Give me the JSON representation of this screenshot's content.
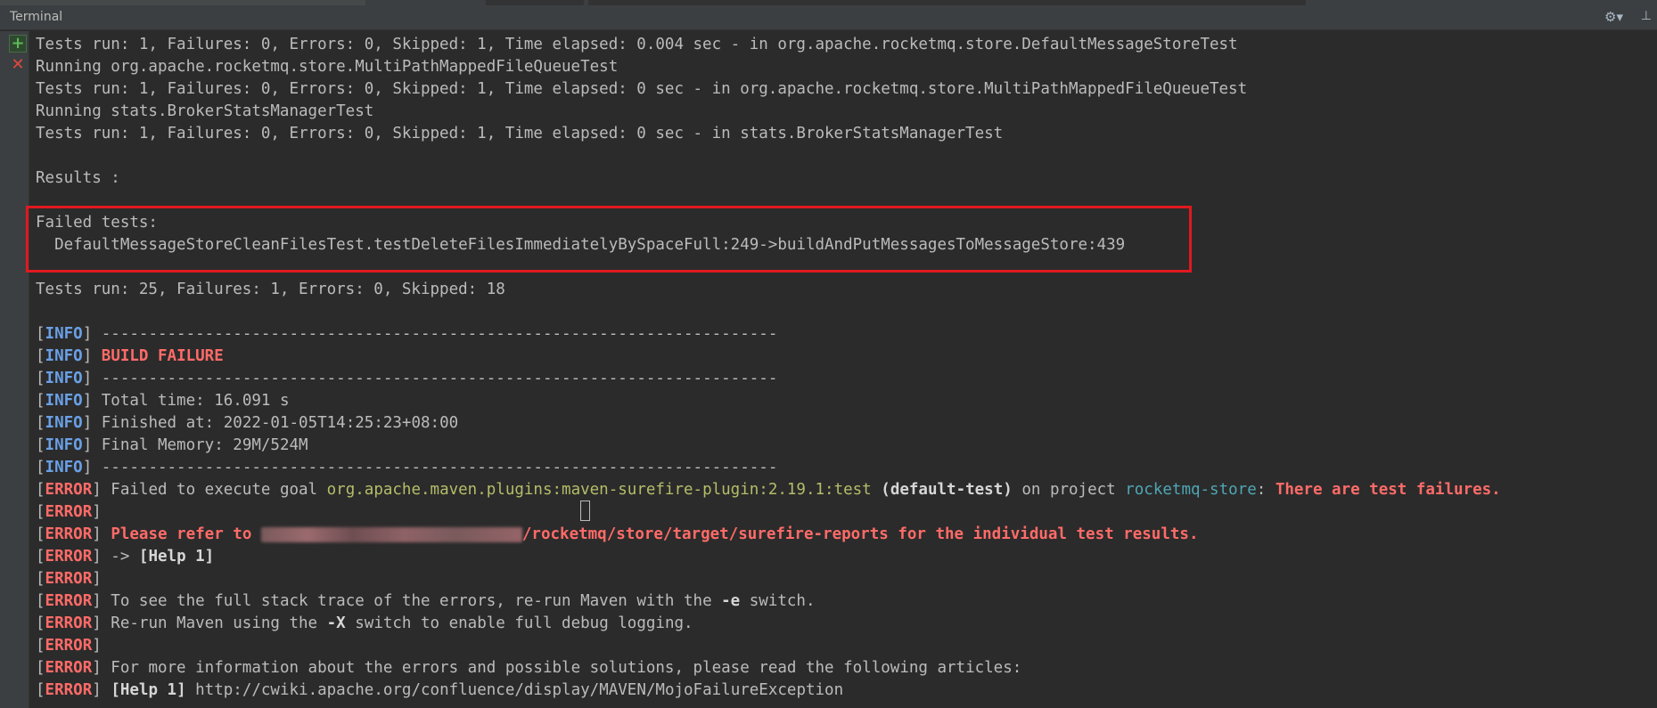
{
  "panel": {
    "title": "Terminal",
    "icons": [
      "gear-icon",
      "hide-panel-icon",
      "new-session-icon",
      "close-session-icon"
    ]
  },
  "colors": {
    "background": "#2b2b2b",
    "info": "#6aa0e6",
    "error": "#ff6b68",
    "plugin": "#b5bd68",
    "project": "#4fa6b4",
    "highlight_box": "#e0191f"
  },
  "lines": [
    [
      {
        "t": "Tests run: 1, Failures: 0, Errors: 0, Skipped: 1, Time elapsed: 0.004 sec - in org.apache.rocketmq.store.DefaultMessageStoreTest"
      }
    ],
    [
      {
        "t": "Running org.apache.rocketmq.store.MultiPathMappedFileQueueTest"
      }
    ],
    [
      {
        "t": "Tests run: 1, Failures: 0, Errors: 0, Skipped: 1, Time elapsed: 0 sec - in org.apache.rocketmq.store.MultiPathMappedFileQueueTest"
      }
    ],
    [
      {
        "t": "Running stats.BrokerStatsManagerTest"
      }
    ],
    [
      {
        "t": "Tests run: 1, Failures: 0, Errors: 0, Skipped: 1, Time elapsed: 0 sec - in stats.BrokerStatsManagerTest"
      }
    ],
    [],
    [
      {
        "t": "Results :"
      }
    ],
    [],
    [
      {
        "t": "Failed tests:"
      }
    ],
    [
      {
        "t": "  DefaultMessageStoreCleanFilesTest.testDeleteFilesImmediatelyBySpaceFull:249->buildAndPutMessagesToMessageStore:439"
      }
    ],
    [],
    [
      {
        "t": "Tests run: 25, Failures: 1, Errors: 0, Skipped: 18"
      }
    ],
    [],
    [
      {
        "t": "[",
        "c": "info-br"
      },
      {
        "t": "INFO",
        "c": "info"
      },
      {
        "t": "] ------------------------------------------------------------------------"
      }
    ],
    [
      {
        "t": "[",
        "c": "info-br"
      },
      {
        "t": "INFO",
        "c": "info"
      },
      {
        "t": "] "
      },
      {
        "t": "BUILD FAILURE",
        "c": "red"
      }
    ],
    [
      {
        "t": "[",
        "c": "info-br"
      },
      {
        "t": "INFO",
        "c": "info"
      },
      {
        "t": "] ------------------------------------------------------------------------"
      }
    ],
    [
      {
        "t": "[",
        "c": "info-br"
      },
      {
        "t": "INFO",
        "c": "info"
      },
      {
        "t": "] Total time: 16.091 s"
      }
    ],
    [
      {
        "t": "[",
        "c": "info-br"
      },
      {
        "t": "INFO",
        "c": "info"
      },
      {
        "t": "] Finished at: 2022-01-05T14:25:23+08:00"
      }
    ],
    [
      {
        "t": "[",
        "c": "info-br"
      },
      {
        "t": "INFO",
        "c": "info"
      },
      {
        "t": "] Final Memory: 29M/524M"
      }
    ],
    [
      {
        "t": "[",
        "c": "info-br"
      },
      {
        "t": "INFO",
        "c": "info"
      },
      {
        "t": "] ------------------------------------------------------------------------"
      }
    ],
    [
      {
        "t": "["
      },
      {
        "t": "ERROR",
        "c": "error"
      },
      {
        "t": "] Failed to execute goal "
      },
      {
        "t": "org.apache.maven.plugins:maven-surefire-plugin:2.19.1:test",
        "c": "green"
      },
      {
        "t": " "
      },
      {
        "t": "(default-test)",
        "c": "bold"
      },
      {
        "t": " on project "
      },
      {
        "t": "rocketmq-store",
        "c": "cyan"
      },
      {
        "t": ": "
      },
      {
        "t": "There are test failures.",
        "c": "red"
      }
    ],
    [
      {
        "t": "["
      },
      {
        "t": "ERROR",
        "c": "error"
      },
      {
        "t": "]"
      }
    ],
    [
      {
        "t": "["
      },
      {
        "t": "ERROR",
        "c": "error"
      },
      {
        "t": "] "
      },
      {
        "t": "Please refer to ",
        "c": "red"
      },
      {
        "t": "",
        "c": "redacted"
      },
      {
        "t": "/rocketmq/store/target/surefire-reports for the individual test results.",
        "c": "red"
      }
    ],
    [
      {
        "t": "["
      },
      {
        "t": "ERROR",
        "c": "error"
      },
      {
        "t": "] -> "
      },
      {
        "t": "[Help 1]",
        "c": "bold"
      }
    ],
    [
      {
        "t": "["
      },
      {
        "t": "ERROR",
        "c": "error"
      },
      {
        "t": "]"
      }
    ],
    [
      {
        "t": "["
      },
      {
        "t": "ERROR",
        "c": "error"
      },
      {
        "t": "] To see the full stack trace of the errors, re-run Maven with the "
      },
      {
        "t": "-e",
        "c": "bold"
      },
      {
        "t": " switch."
      }
    ],
    [
      {
        "t": "["
      },
      {
        "t": "ERROR",
        "c": "error"
      },
      {
        "t": "] Re-run Maven using the "
      },
      {
        "t": "-X",
        "c": "bold"
      },
      {
        "t": " switch to enable full debug logging."
      }
    ],
    [
      {
        "t": "["
      },
      {
        "t": "ERROR",
        "c": "error"
      },
      {
        "t": "]"
      }
    ],
    [
      {
        "t": "["
      },
      {
        "t": "ERROR",
        "c": "error"
      },
      {
        "t": "] For more information about the errors and possible solutions, please read the following articles:"
      }
    ],
    [
      {
        "t": "["
      },
      {
        "t": "ERROR",
        "c": "error"
      },
      {
        "t": "] "
      },
      {
        "t": "[Help 1]",
        "c": "bold"
      },
      {
        "t": " http://cwiki.apache.org/confluence/display/MAVEN/MojoFailureException"
      }
    ]
  ]
}
